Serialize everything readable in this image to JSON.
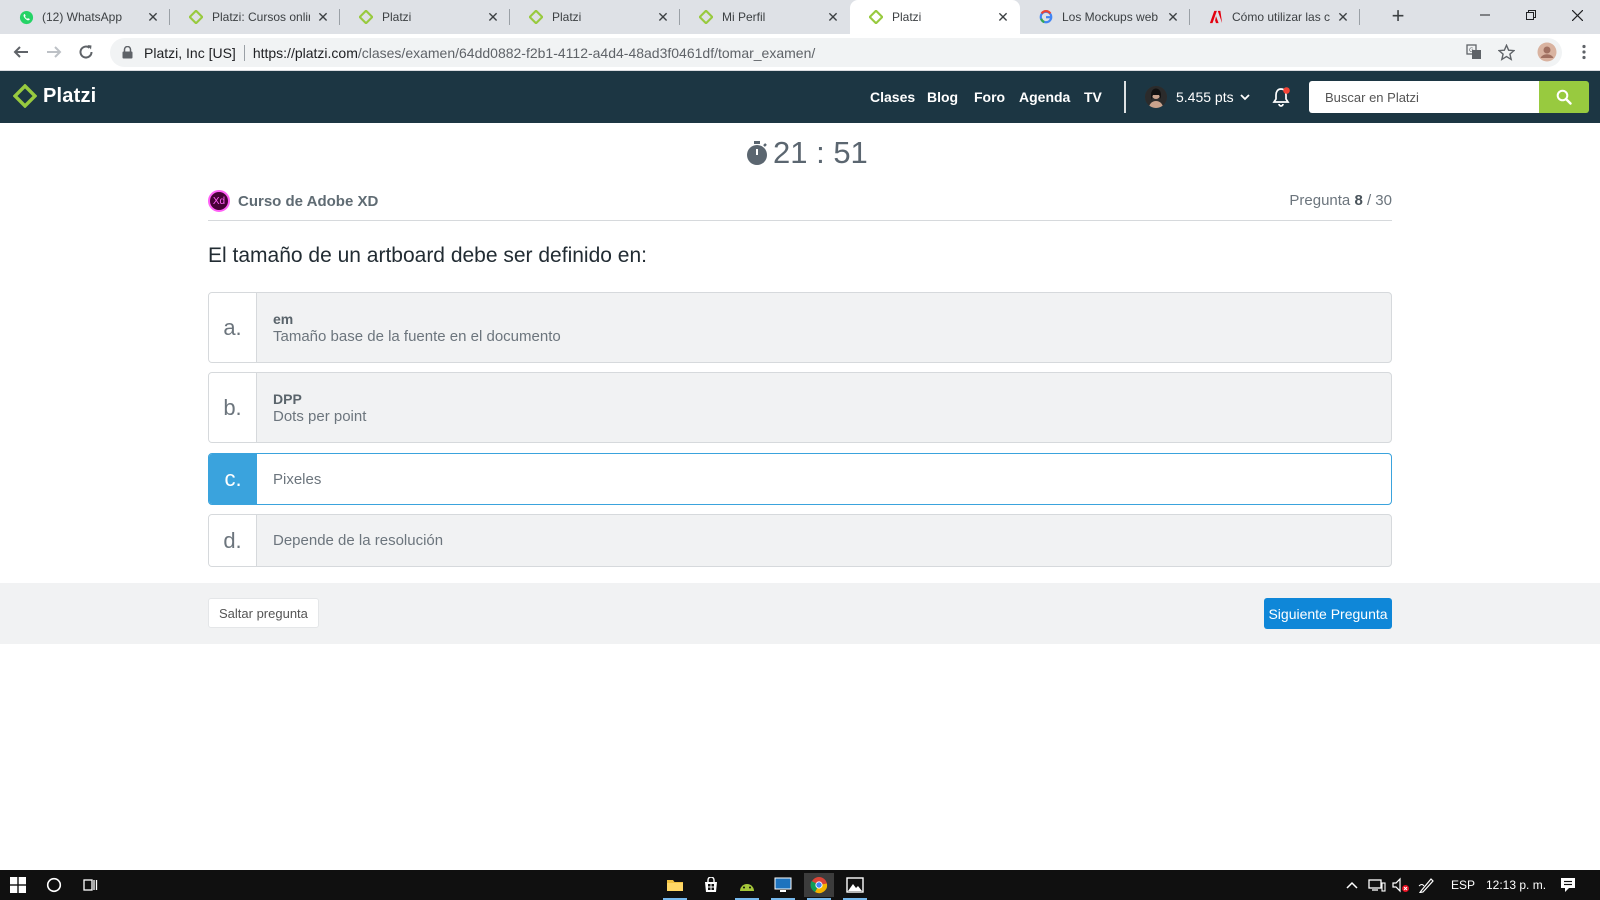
{
  "browser": {
    "tabs": [
      {
        "title": "(12) WhatsApp",
        "icon": "whatsapp-icon"
      },
      {
        "title": "Platzi: Cursos online",
        "icon": "platzi-icon"
      },
      {
        "title": "Platzi",
        "icon": "platzi-icon"
      },
      {
        "title": "Platzi",
        "icon": "platzi-icon"
      },
      {
        "title": "Mi Perfil",
        "icon": "platzi-icon"
      },
      {
        "title": "Platzi",
        "icon": "platzi-icon"
      },
      {
        "title": "Los Mockups web -",
        "icon": "google-icon"
      },
      {
        "title": "Cómo utilizar las cap",
        "icon": "adobe-icon"
      }
    ],
    "active_tab": 5,
    "address": {
      "org": "Platzi, Inc [US]",
      "host": "https://platzi.com",
      "path": "/clases/examen/64dd0882-f2b1-4112-a4d4-48ad3f0461df/tomar_examen/"
    }
  },
  "header": {
    "logo_text": "Platzi",
    "nav": [
      "Clases",
      "Blog",
      "Foro",
      "Agenda",
      "TV"
    ],
    "points": "5.455 pts",
    "search_placeholder": "Buscar en Platzi",
    "accent": "#98ca3f",
    "bg": "#1c3643"
  },
  "exam": {
    "timer": "21 : 51",
    "course_badge": "Xd",
    "course": "Curso de Adobe XD",
    "question_label": "Pregunta",
    "question_current": "8",
    "question_total": "/ 30",
    "question": "El tamaño de un artboard debe ser definido en:",
    "options": [
      {
        "letter": "a.",
        "title": "em",
        "text": "Tamaño base de la fuente en el documento",
        "selected": false
      },
      {
        "letter": "b.",
        "title": "DPP",
        "text": "Dots per point",
        "selected": false
      },
      {
        "letter": "c.",
        "title": "",
        "text": "Pixeles",
        "selected": true
      },
      {
        "letter": "d.",
        "title": "",
        "text": "Depende de la resolución",
        "selected": false
      }
    ],
    "skip_label": "Saltar pregunta",
    "next_label": "Siguiente Pregunta",
    "selected_color": "#3aa3dd",
    "next_color": "#0f87d8"
  },
  "taskbar": {
    "language": "ESP",
    "time": "12:13 p. m."
  }
}
